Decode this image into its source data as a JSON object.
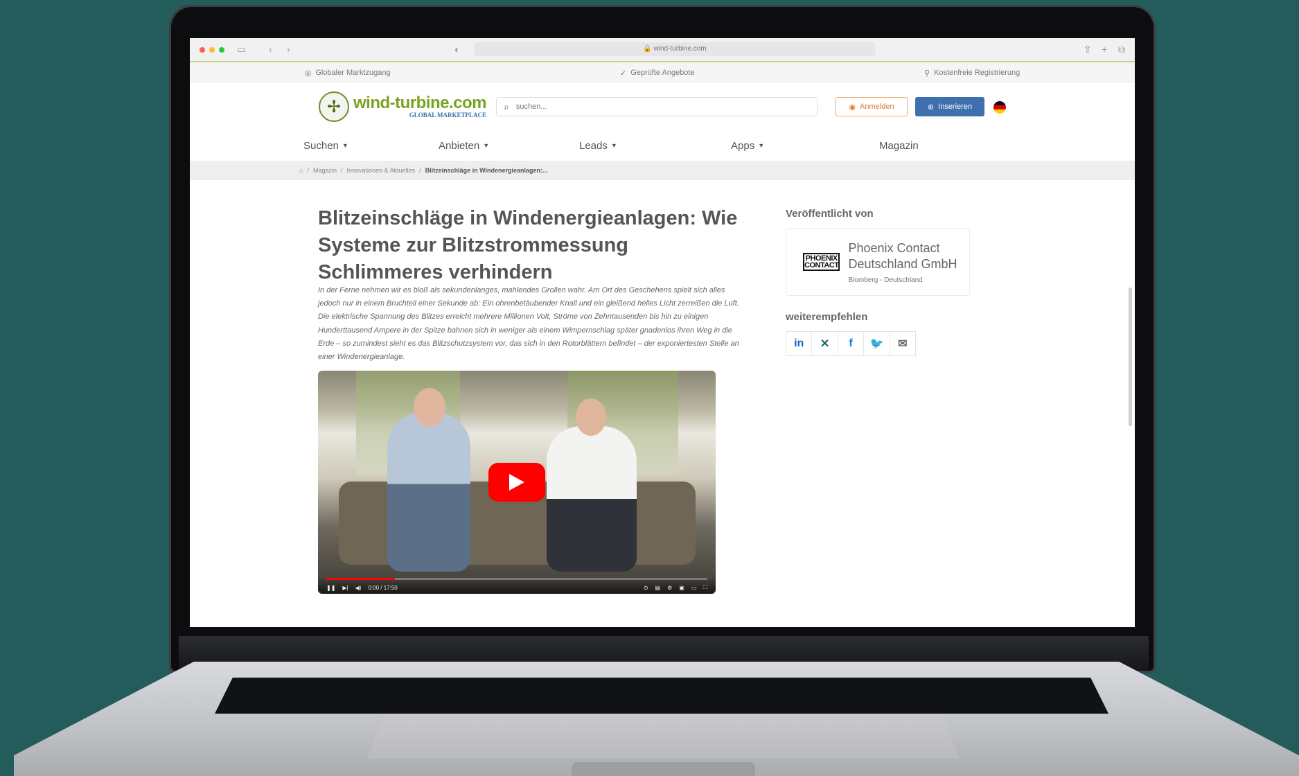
{
  "browser": {
    "url": "wind-turbine.com"
  },
  "topbar": {
    "item1": "Globaler Marktzugang",
    "item2": "Geprüfte Angebote",
    "item3": "Kostenfreie Registrierung"
  },
  "header": {
    "logo_text": "wind-turbine.com",
    "logo_subtext": "GLOBAL MARKETPLACE",
    "search_placeholder": "suchen...",
    "login_label": "Anmelden",
    "insert_label": "Inserieren"
  },
  "nav": {
    "items": [
      {
        "label": "Suchen"
      },
      {
        "label": "Anbieten"
      },
      {
        "label": "Leads"
      },
      {
        "label": "Apps"
      },
      {
        "label": "Magazin"
      }
    ]
  },
  "breadcrumb": {
    "item1": "Magazin",
    "item2": "Innovationen & Aktuelles",
    "current": "Blitzeinschläge in Windenergieanlagen:..."
  },
  "article": {
    "title": "Blitzeinschläge in Windenergieanlagen: Wie Systeme zur Blitzstrommessung Schlimmeres verhindern",
    "lead": "In der Ferne nehmen wir es bloß als sekundenlanges, mahlendes Grollen wahr. Am Ort des Geschehens spielt sich alles jedoch nur in einem Bruchteil einer Sekunde ab: Ein ohrenbetäubender Knall und ein gleißend helles Licht zerreißen die Luft. Die elektrische Spannung des Blitzes erreicht mehrere Millionen Volt, Ströme von Zehntausenden bis hin zu einigen Hunderttausend Ampere in der Spitze bahnen sich in weniger als einem Wimpernschlag später gnadenlos ihren Weg in die Erde – so zumindest sieht es das Blitzschutzsystem vor, das sich in den Rotorblättern befindet – der exponiertesten Stelle an einer Windenergieanlage."
  },
  "video": {
    "progress": 0.18,
    "time": "0:00 / 17:50"
  },
  "sidebar": {
    "published_heading": "Veröffentlicht von",
    "publisher_logo": "PHOENIX CONTACT",
    "publisher_name": "Phoenix Contact Deutschland GmbH",
    "publisher_location": "Blomberg - Deutschland",
    "share_heading": "weiterempfehlen",
    "share": [
      {
        "name": "linkedin",
        "glyph": "in",
        "color": "#0a66c2"
      },
      {
        "name": "xing",
        "glyph": "✕",
        "color": "#126567"
      },
      {
        "name": "facebook",
        "glyph": "f",
        "color": "#1877f2"
      },
      {
        "name": "twitter",
        "glyph": "🐦",
        "color": "#1da1f2"
      },
      {
        "name": "email",
        "glyph": "✉",
        "color": "#666666"
      }
    ]
  },
  "colors": {
    "background": "#245b5b",
    "accent_green": "#7aa222",
    "accent_blue": "#3f6fae",
    "accent_orange": "#d87a2c",
    "youtube_red": "#ff0000"
  }
}
